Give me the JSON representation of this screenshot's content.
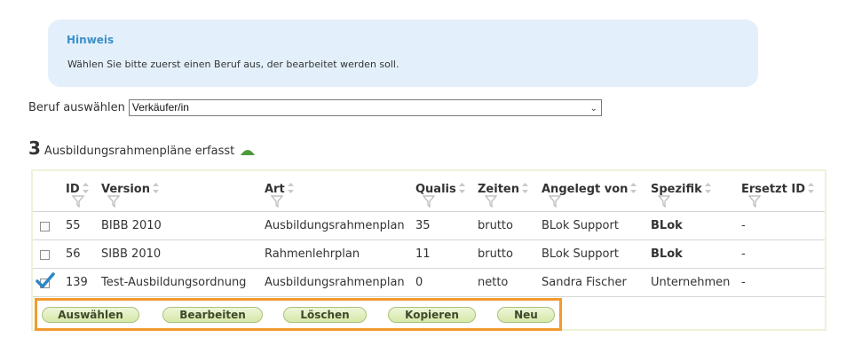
{
  "notice": {
    "title": "Hinweis",
    "text": "Wählen Sie bitte zuerst einen Beruf aus, der bearbeitet werden soll."
  },
  "beruf": {
    "label": "Beruf auswählen",
    "selected": "Verkäufer/in"
  },
  "summary": {
    "count": "3",
    "text": "Ausbildungsrahmenpläne erfasst"
  },
  "table": {
    "headers": {
      "id": "ID",
      "version": "Version",
      "art": "Art",
      "qualis": "Qualis",
      "zeiten": "Zeiten",
      "angelegt": "Angelegt von",
      "spezifik": "Spezifik",
      "ersetzt": "Ersetzt ID"
    },
    "rows": [
      {
        "checked": false,
        "id": "55",
        "version": "BIBB 2010",
        "art": "Ausbildungsrahmenplan",
        "qualis": "35",
        "zeiten": "brutto",
        "angelegt": "BLok Support",
        "spezifik": "BLok",
        "ersetzt": "-"
      },
      {
        "checked": false,
        "id": "56",
        "version": "SIBB 2010",
        "art": "Rahmenlehrplan",
        "qualis": "11",
        "zeiten": "brutto",
        "angelegt": "BLok Support",
        "spezifik": "BLok",
        "ersetzt": "-"
      },
      {
        "checked": true,
        "id": "139",
        "version": "Test-Ausbildungsordnung",
        "art": "Ausbildungsrahmenplan",
        "qualis": "0",
        "zeiten": "netto",
        "angelegt": "Sandra Fischer",
        "spezifik": "Unternehmen",
        "ersetzt": "-"
      }
    ]
  },
  "buttons": {
    "select": "Auswählen",
    "edit": "Bearbeiten",
    "delete": "Löschen",
    "copy": "Kopieren",
    "new": "Neu"
  },
  "colors": {
    "notice_bg": "#e3f0fb",
    "notice_title": "#3d8fc8",
    "accent_green": "#6aa84f",
    "highlight_orange": "#f29a2e",
    "check_blue": "#2a86c4"
  }
}
